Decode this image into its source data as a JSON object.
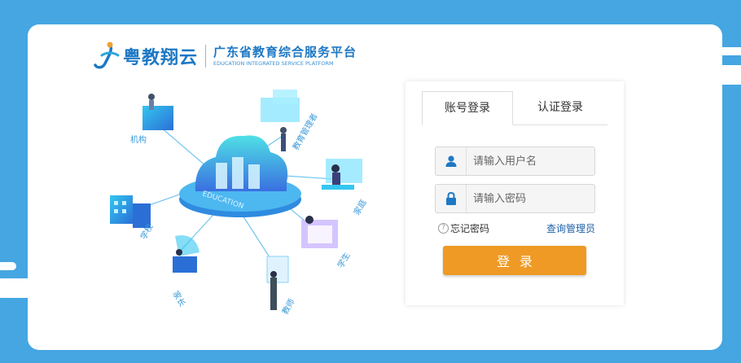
{
  "brand": {
    "name": "粤教翔云",
    "subtitle_cn": "广东省教育综合服务平台",
    "subtitle_en": "EDUCATION INTEGRATED SERVICE PLATFORM"
  },
  "illustration": {
    "center_label": "EDUCATION",
    "nodes": [
      "机构",
      "教育管理者",
      "家庭",
      "学生",
      "教师",
      "家长",
      "学校"
    ]
  },
  "login": {
    "tabs": [
      {
        "label": "账号登录",
        "active": true
      },
      {
        "label": "认证登录",
        "active": false
      }
    ],
    "username": {
      "placeholder": "请输入用户名",
      "icon": "user-icon"
    },
    "password": {
      "placeholder": "请输入密码",
      "icon": "lock-icon"
    },
    "forgot_label": "忘记密码",
    "admin_label": "查询管理员",
    "submit_label": "登录"
  },
  "colors": {
    "background": "#45a6e2",
    "primary": "#1d78c4",
    "button": "#ee9a25"
  }
}
